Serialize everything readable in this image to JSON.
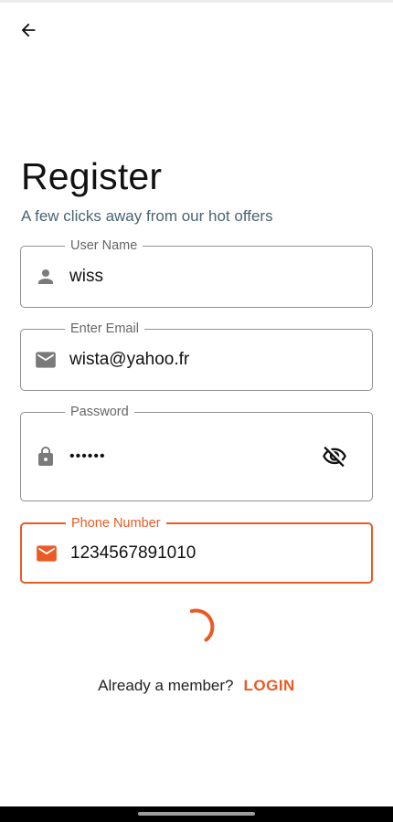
{
  "header": {
    "back_icon": "arrow-left-icon"
  },
  "page": {
    "title": "Register",
    "subtitle": "A few clicks away from our hot offers"
  },
  "form": {
    "username": {
      "label": "User Name",
      "value": "wiss",
      "icon": "person-icon"
    },
    "email": {
      "label": "Enter Email",
      "value": "wista@yahoo.fr",
      "icon": "mail-icon"
    },
    "password": {
      "label": "Password",
      "value": "••••••",
      "icon": "lock-icon",
      "toggle_icon": "eye-off-icon"
    },
    "phone": {
      "label": "Phone Number",
      "value": "1234567891010",
      "icon": "mail-icon"
    }
  },
  "footer": {
    "question": "Already a member?",
    "login_label": "LOGIN"
  },
  "colors": {
    "accent": "#ea5a23",
    "subtitle": "#4a6472",
    "icon": "#7a7a7a",
    "border": "#8f8f8f"
  }
}
